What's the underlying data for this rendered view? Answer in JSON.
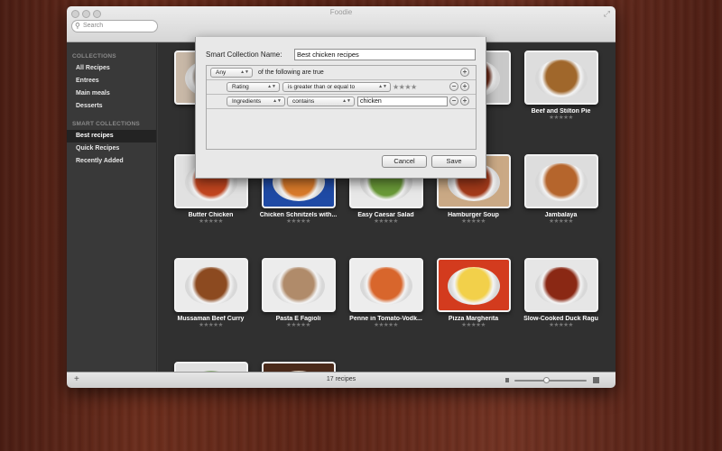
{
  "window": {
    "title": "Foodie",
    "search_placeholder": "Search"
  },
  "sidebar": {
    "collections_header": "COLLECTIONS",
    "collections": [
      {
        "label": "All Recipes"
      },
      {
        "label": "Entrees"
      },
      {
        "label": "Main meals"
      },
      {
        "label": "Desserts"
      }
    ],
    "smart_header": "SMART COLLECTIONS",
    "smart": [
      {
        "label": "Best recipes",
        "selected": true
      },
      {
        "label": "Quick Recipes"
      },
      {
        "label": "Recently Added"
      }
    ]
  },
  "recipes": [
    {
      "name": "Al",
      "colors": [
        "#c9b9a8",
        "#8a7a6a"
      ]
    },
    {
      "name": "",
      "colors": [
        "#d5d5d5",
        "#b33"
      ]
    },
    {
      "name": "",
      "colors": [
        "#d8d8d8",
        "#7a4a22"
      ]
    },
    {
      "name": "arinade",
      "colors": [
        "#c9c9c9",
        "#6a2a18"
      ]
    },
    {
      "name": "Beef and Stilton Pie",
      "colors": [
        "#ddd",
        "#a0672b"
      ]
    },
    {
      "name": "Butter Chicken",
      "colors": [
        "#e1e1e1",
        "#c2451f"
      ]
    },
    {
      "name": "Chicken Schnitzels with...",
      "colors": [
        "#1f4aa5",
        "#d97a2a"
      ]
    },
    {
      "name": "Easy Caesar Salad",
      "colors": [
        "#e8e8e8",
        "#6a9a38"
      ]
    },
    {
      "name": "Hamburger Soup",
      "colors": [
        "#caa985",
        "#a33a1a"
      ]
    },
    {
      "name": "Jambalaya",
      "colors": [
        "#ddd",
        "#b5652c"
      ]
    },
    {
      "name": "Mussaman Beef Curry",
      "colors": [
        "#ebebeb",
        "#8c4a20"
      ]
    },
    {
      "name": "Pasta E Fagioli",
      "colors": [
        "#ececec",
        "#b08b6a"
      ]
    },
    {
      "name": "Penne in Tomato-Vodk...",
      "colors": [
        "#ededed",
        "#d8662c"
      ]
    },
    {
      "name": "Pizza Margherita",
      "colors": [
        "#d33b1e",
        "#f2d04a"
      ]
    },
    {
      "name": "Slow-Cooked Duck Ragu",
      "colors": [
        "#e6e6e6",
        "#8a2814"
      ]
    },
    {
      "name": "",
      "colors": [
        "#e0e0e0",
        "#5a8a3a"
      ]
    },
    {
      "name": "",
      "colors": [
        "#4a2a1a",
        "#d8c0a0"
      ]
    }
  ],
  "stars": "★★★★★",
  "status": {
    "count": "17 recipes"
  },
  "sheet": {
    "name_label": "Smart Collection Name:",
    "name_value": "Best chicken recipes",
    "match_popup": "Any",
    "match_text": "of the following are true",
    "rule1_field": "Rating",
    "rule1_operator": "is greater than or equal to",
    "rule1_stars": "★★★★",
    "rule2_field": "Ingredients",
    "rule2_operator": "contains",
    "rule2_value": "chicken",
    "cancel": "Cancel",
    "save": "Save"
  }
}
